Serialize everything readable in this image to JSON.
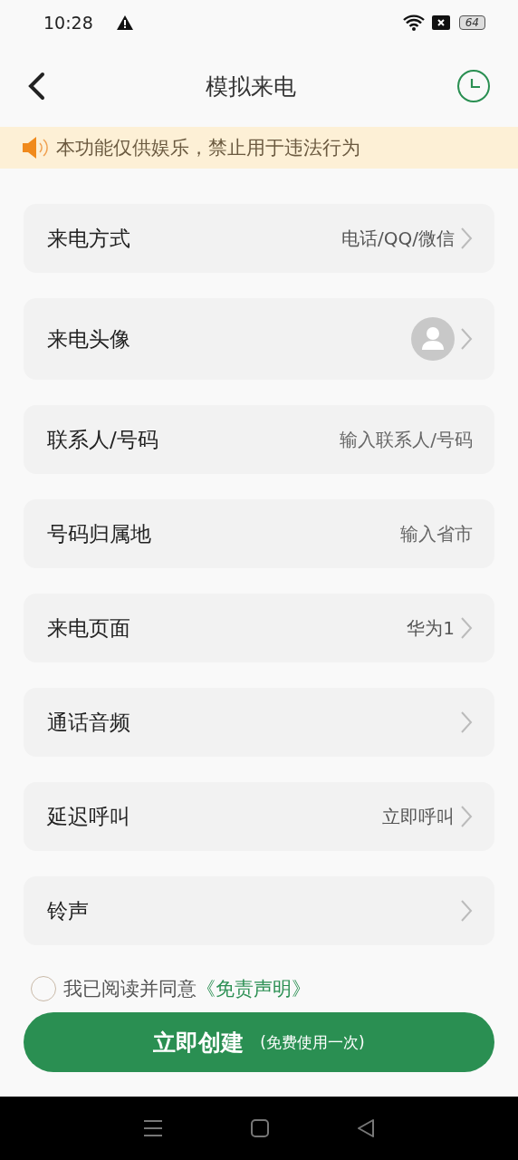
{
  "status_bar": {
    "time": "10:28",
    "battery": "64"
  },
  "header": {
    "title": "模拟来电"
  },
  "notice": {
    "text": "本功能仅供娱乐，禁止用于违法行为"
  },
  "settings": [
    {
      "kind": "select",
      "label": "来电方式",
      "value": "电话/QQ/微信"
    },
    {
      "kind": "avatar",
      "label": "来电头像"
    },
    {
      "kind": "input",
      "label": "联系人/号码",
      "placeholder": "输入联系人/号码"
    },
    {
      "kind": "input",
      "label": "号码归属地",
      "placeholder": "输入省市"
    },
    {
      "kind": "select",
      "label": "来电页面",
      "value": "华为1"
    },
    {
      "kind": "select",
      "label": "通话音频"
    },
    {
      "kind": "select",
      "label": "延迟呼叫",
      "value": "立即呼叫"
    },
    {
      "kind": "select",
      "label": "铃声"
    }
  ],
  "agreement": {
    "checked": false,
    "text": "我已阅读并同意",
    "link": "《免责声明》"
  },
  "create_button": {
    "label": "立即创建",
    "note": "(免费使用一次)"
  }
}
